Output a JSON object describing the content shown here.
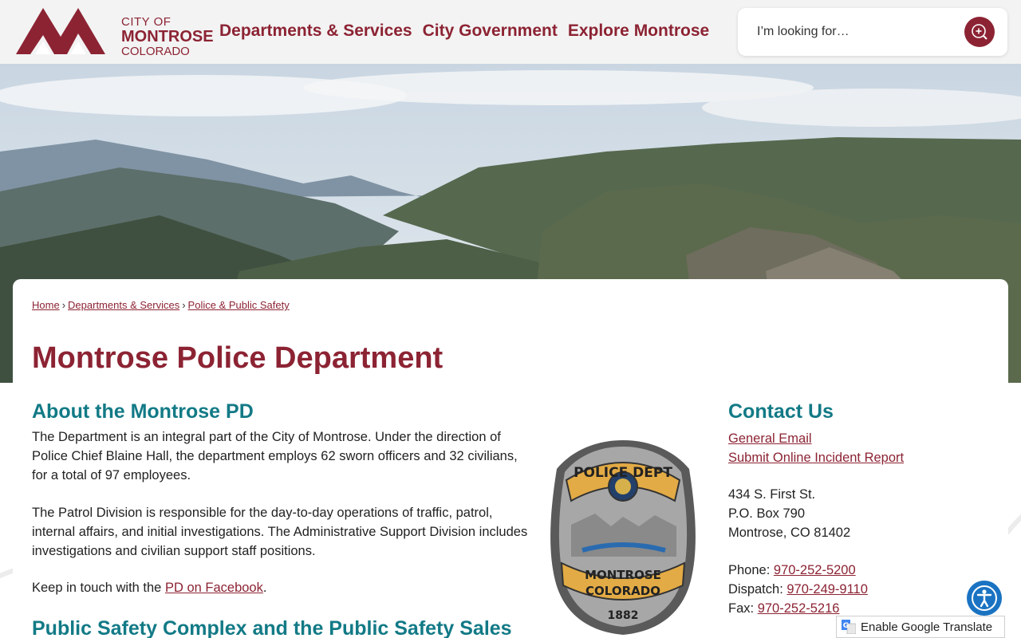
{
  "header": {
    "logo": {
      "line1": "CITY OF",
      "line2": "MONTROSE",
      "line3": "COLORADO"
    },
    "nav": [
      "Departments & Services",
      "City Government",
      "Explore Montrose"
    ],
    "search": {
      "placeholder": "I’m looking for…"
    }
  },
  "breadcrumb": {
    "home": "Home",
    "sep": "›",
    "departments": "Departments & Services",
    "police": "Police & Public Safety"
  },
  "page": {
    "title": "Montrose Police Department",
    "about_heading": "About the Montrose PD",
    "about_p1": "The Department is an integral part of the City of Montrose. Under the direction of Police Chief Blaine Hall, the department employs 62 sworn officers and 32 civilians, for a total of 97 employees.",
    "about_p2": "The Patrol Division is responsible for the day-to-day operations of traffic, patrol, internal affairs, and initial investigations. The Administrative Support Division includes investigations and civilian support staff positions.",
    "about_p3_prefix": "Keep in touch with the ",
    "about_p3_link": "PD on Facebook",
    "about_p3_suffix": ".",
    "section2_heading": "Public Safety Complex and the Public Safety Sales"
  },
  "badge": {
    "top": "POLICE DEPT",
    "bottom1": "MONTROSE",
    "bottom2": "COLORADO",
    "year": "1882"
  },
  "contact": {
    "heading": "Contact Us",
    "general_email": "General Email",
    "incident_report": "Submit Online Incident Report",
    "address1": "434 S. First St.",
    "address2": "P.O. Box 790",
    "address3": "Montrose, CO 81402",
    "phone_label": "Phone:",
    "phone": "970-252-5200",
    "dispatch_label": "Dispatch:",
    "dispatch": "970-249-9110",
    "fax_label": "Fax:",
    "fax": "970-252-5216"
  },
  "translate": {
    "label": "Enable Google Translate"
  },
  "icons": {
    "search": "search-plus-icon",
    "accessibility": "accessibility-icon",
    "translate": "google-translate-icon"
  },
  "colors": {
    "brand": "#8c2333",
    "heading_teal": "#127a86",
    "accessibility": "#1a73c2"
  }
}
